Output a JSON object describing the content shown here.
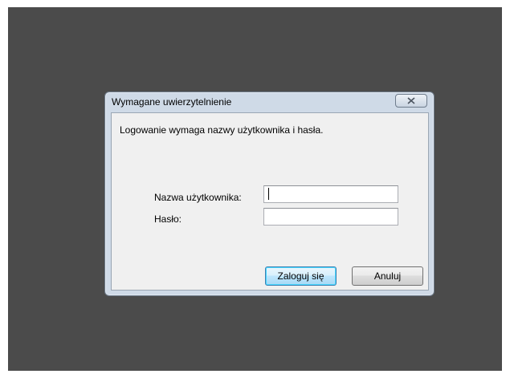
{
  "dialog": {
    "title": "Wymagane uwierzytelnienie",
    "close_icon": "close-icon",
    "message": "Logowanie wymaga nazwy użytkownika i hasła.",
    "username_label": "Nazwa użytkownika:",
    "username_value": "",
    "password_label": "Hasło:",
    "password_value": "",
    "login_button": "Zaloguj się",
    "cancel_button": "Anuluj"
  },
  "colors": {
    "desktop": "#4b4b4b",
    "dialog_frame": "#cfdae7",
    "client_bg": "#f0f0f0",
    "default_button_border": "#3c7fb1"
  }
}
